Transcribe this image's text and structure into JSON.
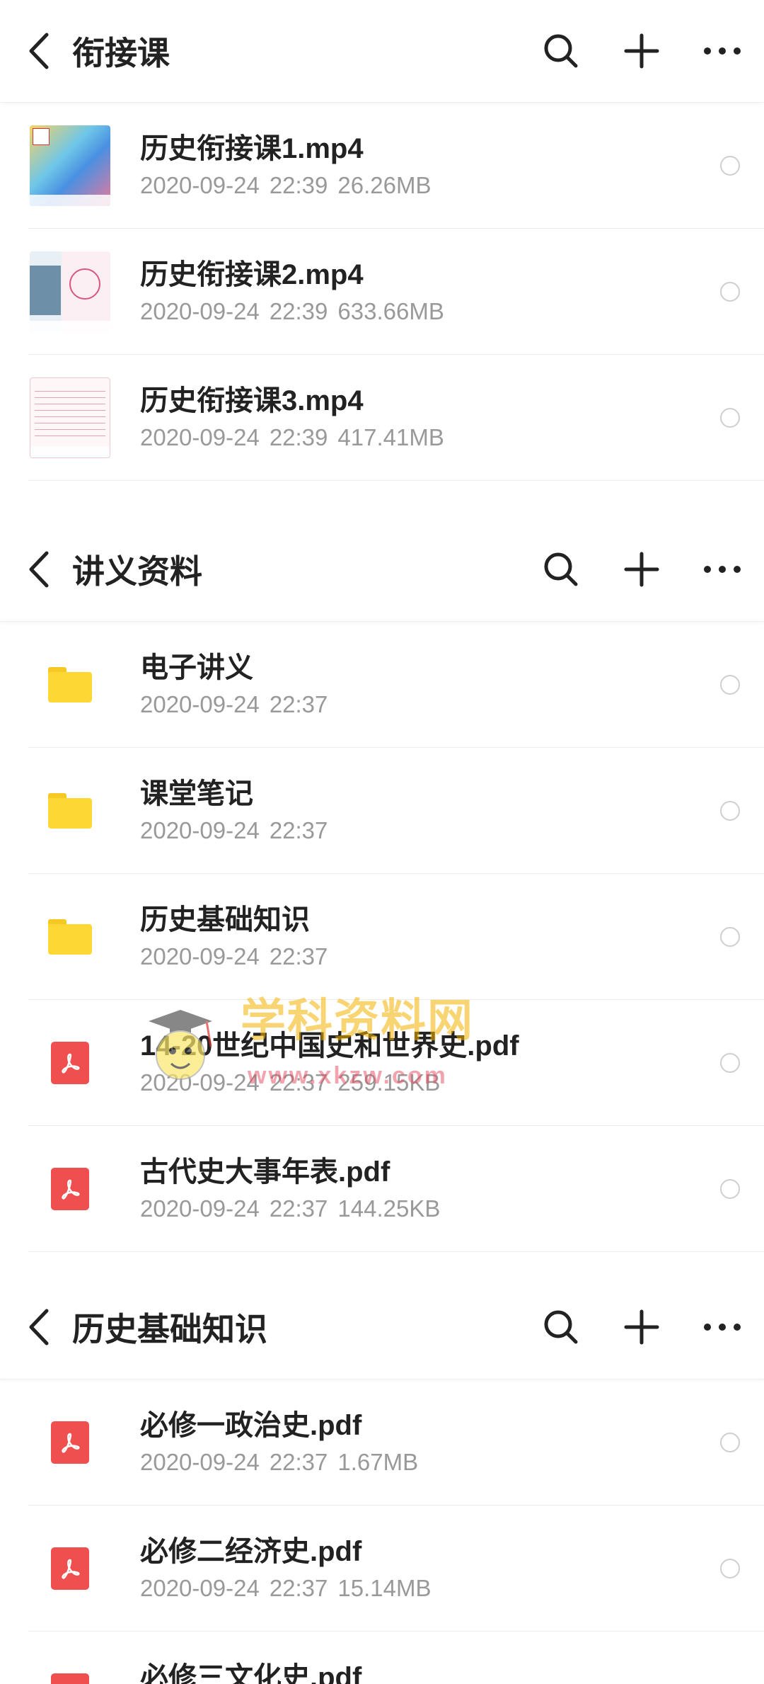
{
  "panels": [
    {
      "title": "衔接课",
      "files": [
        {
          "name": "历史衔接课1.mp4",
          "date": "2020-09-24",
          "time": "22:39",
          "size": "26.26MB",
          "type": "video"
        },
        {
          "name": "历史衔接课2.mp4",
          "date": "2020-09-24",
          "time": "22:39",
          "size": "633.66MB",
          "type": "video"
        },
        {
          "name": "历史衔接课3.mp4",
          "date": "2020-09-24",
          "time": "22:39",
          "size": "417.41MB",
          "type": "video"
        }
      ]
    },
    {
      "title": "讲义资料",
      "files": [
        {
          "name": "电子讲义",
          "date": "2020-09-24",
          "time": "22:37",
          "size": "",
          "type": "folder"
        },
        {
          "name": "课堂笔记",
          "date": "2020-09-24",
          "time": "22:37",
          "size": "",
          "type": "folder"
        },
        {
          "name": "历史基础知识",
          "date": "2020-09-24",
          "time": "22:37",
          "size": "",
          "type": "folder"
        },
        {
          "name": "14-20世纪中国史和世界史.pdf",
          "date": "2020-09-24",
          "time": "22:37",
          "size": "259.15KB",
          "type": "pdf"
        },
        {
          "name": "古代史大事年表.pdf",
          "date": "2020-09-24",
          "time": "22:37",
          "size": "144.25KB",
          "type": "pdf"
        }
      ]
    },
    {
      "title": "历史基础知识",
      "files": [
        {
          "name": "必修一政治史.pdf",
          "date": "2020-09-24",
          "time": "22:37",
          "size": "1.67MB",
          "type": "pdf"
        },
        {
          "name": "必修二经济史.pdf",
          "date": "2020-09-24",
          "time": "22:37",
          "size": "15.14MB",
          "type": "pdf"
        },
        {
          "name": "必修三文化史.pdf",
          "date": "",
          "time": "",
          "size": "",
          "type": "pdf"
        }
      ]
    }
  ],
  "icons": {
    "back": "chevron-left-icon",
    "search": "search-icon",
    "add": "plus-icon",
    "more": "more-horizontal-icon",
    "folder": "folder-icon",
    "pdf": "pdf-file-icon"
  },
  "colors": {
    "folder": "#fdd835",
    "pdf": "#ef4f4f",
    "meta_text": "#999999",
    "divider": "#ececec"
  },
  "watermark": {
    "text": "学科资料网",
    "url": "www.xkzw.com"
  }
}
